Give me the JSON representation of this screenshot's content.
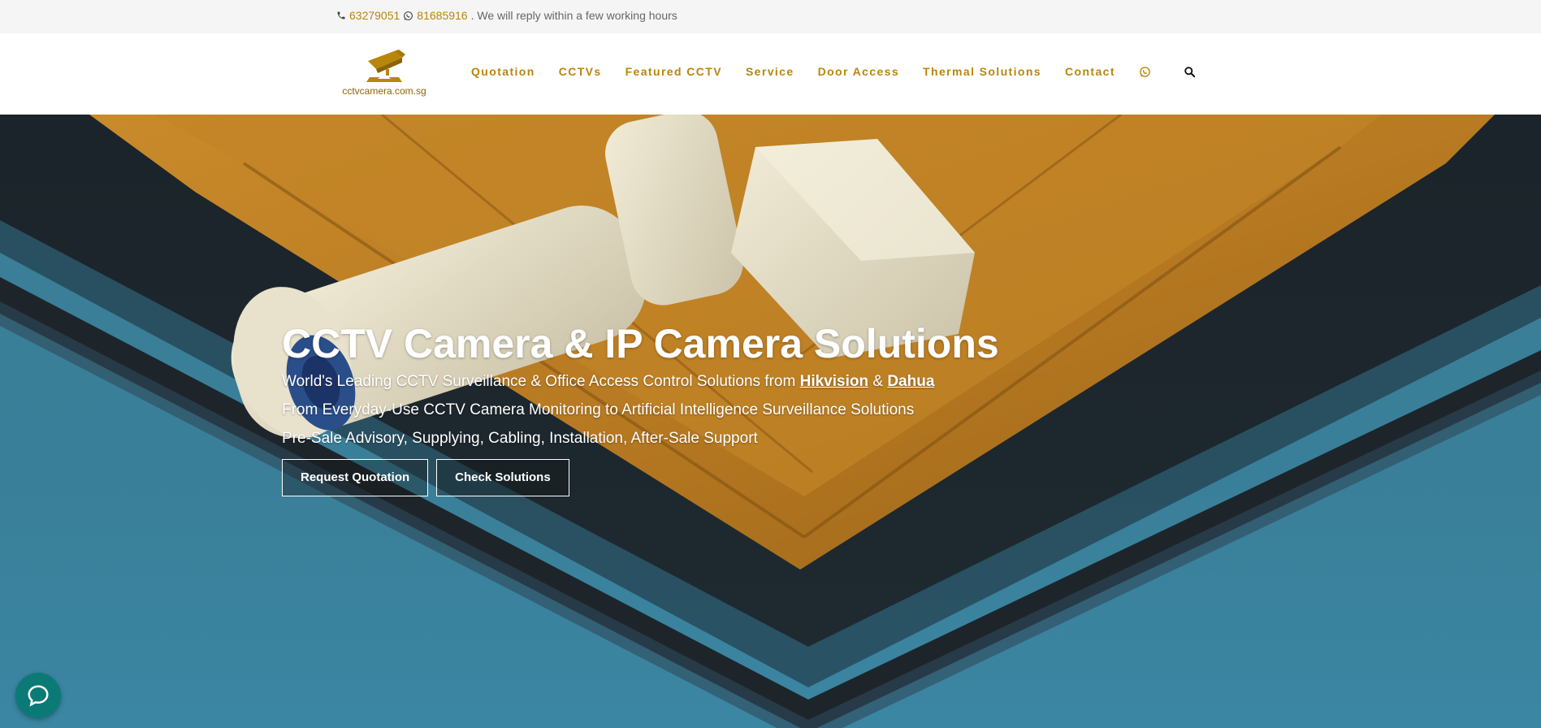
{
  "topbar": {
    "phone": "63279051",
    "whatsapp": "81685916",
    "message": ". We will reply within a few working hours"
  },
  "header": {
    "logo_text": "cctvcamera.com.sg",
    "nav": [
      {
        "label": "Quotation"
      },
      {
        "label": "CCTVs"
      },
      {
        "label": "Featured CCTV"
      },
      {
        "label": "Service"
      },
      {
        "label": "Door Access"
      },
      {
        "label": "Thermal Solutions"
      },
      {
        "label": "Contact"
      }
    ],
    "icons": [
      "whatsapp-icon",
      "search-icon"
    ]
  },
  "hero": {
    "title": "CCTV Camera & IP Camera Solutions",
    "line1_prefix": "World's Leading CCTV Surveillance & Office Access Control Solutions from ",
    "line1_link1": "Hikvision",
    "line1_amp": " & ",
    "line1_link2": "Dahua",
    "line2": "From Everyday-Use CCTV Camera Monitoring to Artificial Intelligence Surveillance Solutions",
    "line3": "Pre-Sale Advisory, Supplying, Cabling, Installation, After-Sale Support",
    "buttons": {
      "primary": "Request Quotation",
      "secondary": "Check Solutions"
    }
  },
  "colors": {
    "accent": "#b8860b",
    "chat": "#0b7a77"
  }
}
